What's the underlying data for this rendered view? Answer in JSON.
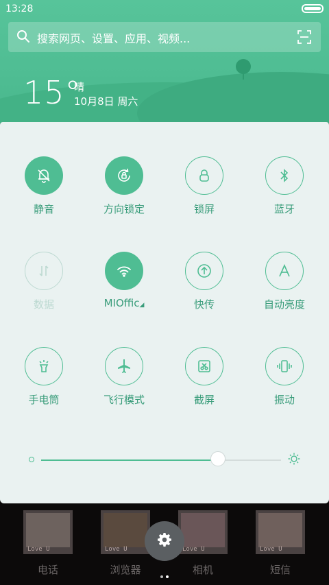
{
  "status_bar": {
    "time": "13:28"
  },
  "search": {
    "placeholder": "搜索网页、设置、应用、视频..."
  },
  "weather": {
    "temperature": "15°",
    "condition": "晴",
    "date": "10月8日 周六"
  },
  "toggles": [
    {
      "label": "静音",
      "icon": "bell-off-icon",
      "state": "on"
    },
    {
      "label": "方向锁定",
      "icon": "rotation-lock-icon",
      "state": "on"
    },
    {
      "label": "锁屏",
      "icon": "lock-icon",
      "state": "off"
    },
    {
      "label": "蓝牙",
      "icon": "bluetooth-icon",
      "state": "off"
    },
    {
      "label": "数据",
      "icon": "mobile-data-icon",
      "state": "disabled"
    },
    {
      "label": "MIOffic",
      "icon": "wifi-icon",
      "state": "on"
    },
    {
      "label": "快传",
      "icon": "transfer-icon",
      "state": "off"
    },
    {
      "label": "自动亮度",
      "icon": "auto-brightness-icon",
      "state": "off"
    },
    {
      "label": "手电筒",
      "icon": "flashlight-icon",
      "state": "off"
    },
    {
      "label": "飞行模式",
      "icon": "airplane-icon",
      "state": "off"
    },
    {
      "label": "截屏",
      "icon": "screenshot-icon",
      "state": "off"
    },
    {
      "label": "振动",
      "icon": "vibrate-icon",
      "state": "off"
    }
  ],
  "brightness": {
    "level": 0.74
  },
  "dock": {
    "apps": [
      {
        "label": "电话",
        "caption": "Love U"
      },
      {
        "label": "浏览器",
        "caption": "Love U"
      },
      {
        "label": "相机",
        "caption": "Love U"
      },
      {
        "label": "短信",
        "caption": "Love U"
      }
    ]
  },
  "colors": {
    "accent": "#4fbd93",
    "panel": "#eaf2f1",
    "header": "#57c49a"
  }
}
